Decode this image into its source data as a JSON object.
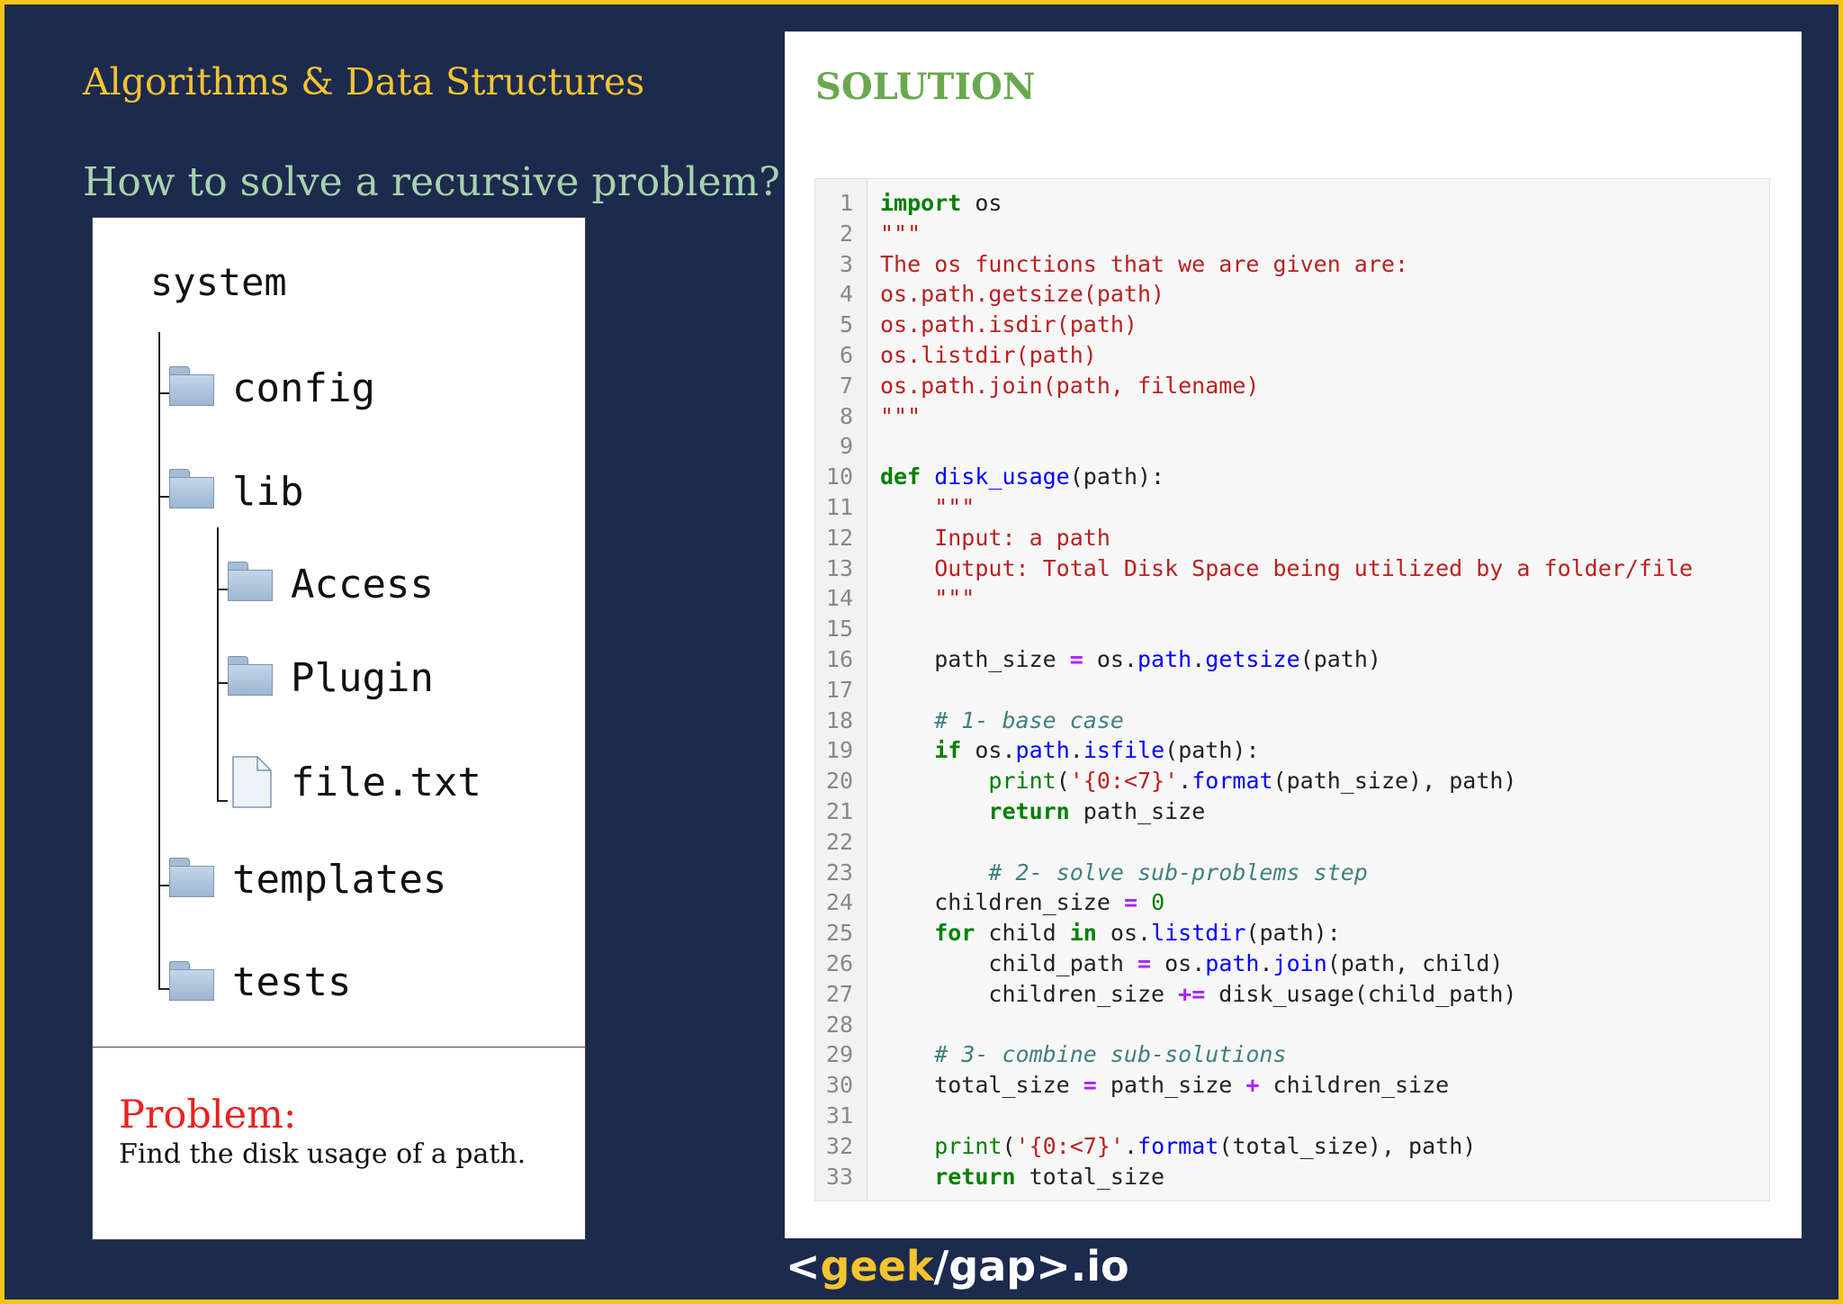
{
  "header": {
    "title": "Algorithms & Data Structures",
    "subtitle": "How to solve a recursive problem?"
  },
  "tree": {
    "root": "system",
    "items": [
      {
        "label": "config",
        "icon": "folder-icon"
      },
      {
        "label": "lib",
        "icon": "folder-icon"
      },
      {
        "label": "Access",
        "icon": "folder-icon"
      },
      {
        "label": "Plugin",
        "icon": "folder-icon"
      },
      {
        "label": "file.txt",
        "icon": "file-icon"
      },
      {
        "label": "templates",
        "icon": "folder-icon"
      },
      {
        "label": "tests",
        "icon": "folder-icon"
      }
    ]
  },
  "problem": {
    "heading": "Problem:",
    "text": "Find the disk usage of a path."
  },
  "solution": {
    "title": "SOLUTION",
    "code_lines": [
      [
        [
          "kw",
          "import"
        ],
        [
          "pl",
          " os"
        ]
      ],
      [
        [
          "str",
          "\"\"\""
        ]
      ],
      [
        [
          "str",
          "The os functions that we are given are:"
        ]
      ],
      [
        [
          "str",
          "os.path.getsize(path)"
        ]
      ],
      [
        [
          "str",
          "os.path.isdir(path)"
        ]
      ],
      [
        [
          "str",
          "os.listdir(path)"
        ]
      ],
      [
        [
          "str",
          "os.path.join(path, filename)"
        ]
      ],
      [
        [
          "str",
          "\"\"\""
        ]
      ],
      [],
      [
        [
          "kw",
          "def"
        ],
        [
          "pl",
          " "
        ],
        [
          "fn",
          "disk_usage"
        ],
        [
          "pl",
          "(path):"
        ]
      ],
      [
        [
          "str",
          "    \"\"\""
        ]
      ],
      [
        [
          "str",
          "    Input: a path"
        ]
      ],
      [
        [
          "str",
          "    Output: Total Disk Space being utilized by a folder/file"
        ]
      ],
      [
        [
          "str",
          "    \"\"\""
        ]
      ],
      [],
      [
        [
          "pl",
          "    path_size "
        ],
        [
          "op",
          "="
        ],
        [
          "pl",
          " os."
        ],
        [
          "fn",
          "path"
        ],
        [
          "pl",
          "."
        ],
        [
          "fn",
          "getsize"
        ],
        [
          "pl",
          "(path)"
        ]
      ],
      [],
      [
        [
          "cm",
          "    # 1- base case"
        ]
      ],
      [
        [
          "pl",
          "    "
        ],
        [
          "kw",
          "if"
        ],
        [
          "pl",
          " os."
        ],
        [
          "fn",
          "path"
        ],
        [
          "pl",
          "."
        ],
        [
          "fn",
          "isfile"
        ],
        [
          "pl",
          "(path):"
        ]
      ],
      [
        [
          "pl",
          "        "
        ],
        [
          "bi",
          "print"
        ],
        [
          "pl",
          "("
        ],
        [
          "str",
          "'{0:<7}'"
        ],
        [
          "pl",
          "."
        ],
        [
          "fn",
          "format"
        ],
        [
          "pl",
          "(path_size), path)"
        ]
      ],
      [
        [
          "pl",
          "        "
        ],
        [
          "kw",
          "return"
        ],
        [
          "pl",
          " path_size"
        ]
      ],
      [],
      [
        [
          "cm",
          "        # 2- solve sub-problems step"
        ]
      ],
      [
        [
          "pl",
          "    children_size "
        ],
        [
          "op",
          "="
        ],
        [
          "pl",
          " "
        ],
        [
          "bi",
          "0"
        ]
      ],
      [
        [
          "pl",
          "    "
        ],
        [
          "kw",
          "for"
        ],
        [
          "pl",
          " child "
        ],
        [
          "kw",
          "in"
        ],
        [
          "pl",
          " os."
        ],
        [
          "fn",
          "listdir"
        ],
        [
          "pl",
          "(path):"
        ]
      ],
      [
        [
          "pl",
          "        child_path "
        ],
        [
          "op",
          "="
        ],
        [
          "pl",
          " os."
        ],
        [
          "fn",
          "path"
        ],
        [
          "pl",
          "."
        ],
        [
          "fn",
          "join"
        ],
        [
          "pl",
          "(path, child)"
        ]
      ],
      [
        [
          "pl",
          "        children_size "
        ],
        [
          "op",
          "+="
        ],
        [
          "pl",
          " disk_usage(child_path)"
        ]
      ],
      [],
      [
        [
          "cm",
          "    # 3- combine sub-solutions"
        ]
      ],
      [
        [
          "pl",
          "    total_size "
        ],
        [
          "op",
          "="
        ],
        [
          "pl",
          " path_size "
        ],
        [
          "op",
          "+"
        ],
        [
          "pl",
          " children_size"
        ]
      ],
      [],
      [
        [
          "pl",
          "    "
        ],
        [
          "bi",
          "print"
        ],
        [
          "pl",
          "("
        ],
        [
          "str",
          "'{0:<7}'"
        ],
        [
          "pl",
          "."
        ],
        [
          "fn",
          "format"
        ],
        [
          "pl",
          "(total_size), path)"
        ]
      ],
      [
        [
          "pl",
          "    "
        ],
        [
          "kw",
          "return"
        ],
        [
          "pl",
          " total_size"
        ]
      ]
    ]
  },
  "logo": {
    "open": "<",
    "geek": "geek",
    "slash": "/",
    "gap": "gap",
    "close": ">",
    "suffix": ".io"
  }
}
